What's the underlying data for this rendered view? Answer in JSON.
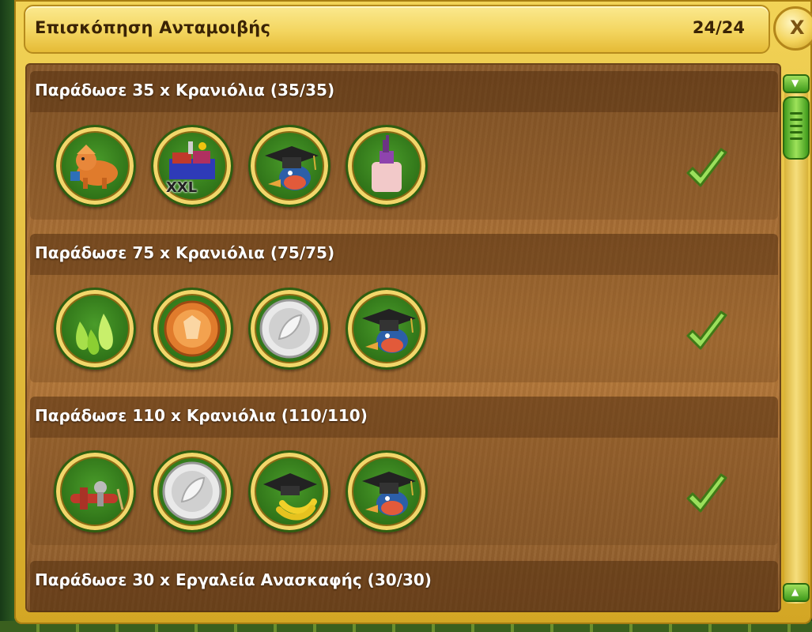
{
  "header": {
    "title": "Επισκόπηση Ανταμοιβής",
    "counter": "24/24",
    "close_label": "X"
  },
  "sections": [
    {
      "title": "Παράδωσε 35 x Κρανιόλια (35/35)",
      "rewards": [
        "triceratops-dino-icon",
        "xxl-toolbox-icon",
        "graduation-bird-icon",
        "potion-bottle-icon"
      ],
      "reward_badge": "XXL",
      "completed": true
    },
    {
      "title": "Παράδωσε 75 x Κρανιόλια (75/75)",
      "rewards": [
        "green-drops-icon",
        "bronze-medal-icon",
        "silver-coin-icon",
        "graduation-bird-icon"
      ],
      "completed": true
    },
    {
      "title": "Παράδωσε 110 x Κρανιόλια (110/110)",
      "rewards": [
        "plane-dino-icon",
        "silver-coin-icon",
        "graduation-bananas-icon",
        "graduation-bird-icon"
      ],
      "completed": true
    },
    {
      "title": "Παράδωσε 30 x Εργαλεία Ανασκαφής (30/30)"
    }
  ],
  "colors": {
    "frame": "#f2d357",
    "wood": "#a66d34",
    "check": "#8bd84a",
    "reward_ring": "#f2d66a"
  }
}
